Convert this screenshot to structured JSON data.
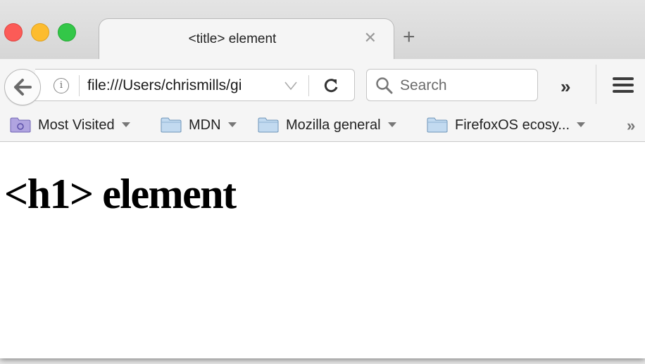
{
  "window": {
    "controls": [
      "close",
      "minimize",
      "zoom"
    ],
    "colors": {
      "close": "#fc5b57",
      "minimize": "#fdbc2e",
      "zoom": "#33c748"
    }
  },
  "tab": {
    "title": "<title> element",
    "close_icon": "close-icon",
    "new_tab_label": "+"
  },
  "navbar": {
    "back_icon": "back-arrow-icon",
    "info_icon_glyph": "i",
    "url": "file:///Users/chrismills/gi",
    "reload_icon": "reload-icon",
    "search_placeholder": "Search",
    "overflow_label": "»",
    "menu_icon": "hamburger-menu-icon"
  },
  "bookmarks": {
    "items": [
      {
        "label": "Most Visited",
        "icon": "smart-folder-icon"
      },
      {
        "label": "MDN",
        "icon": "folder-icon"
      },
      {
        "label": "Mozilla general",
        "icon": "folder-icon"
      },
      {
        "label": "FirefoxOS ecosy...",
        "icon": "folder-icon"
      }
    ],
    "overflow_label": "»"
  },
  "content": {
    "heading": "<h1> element"
  }
}
